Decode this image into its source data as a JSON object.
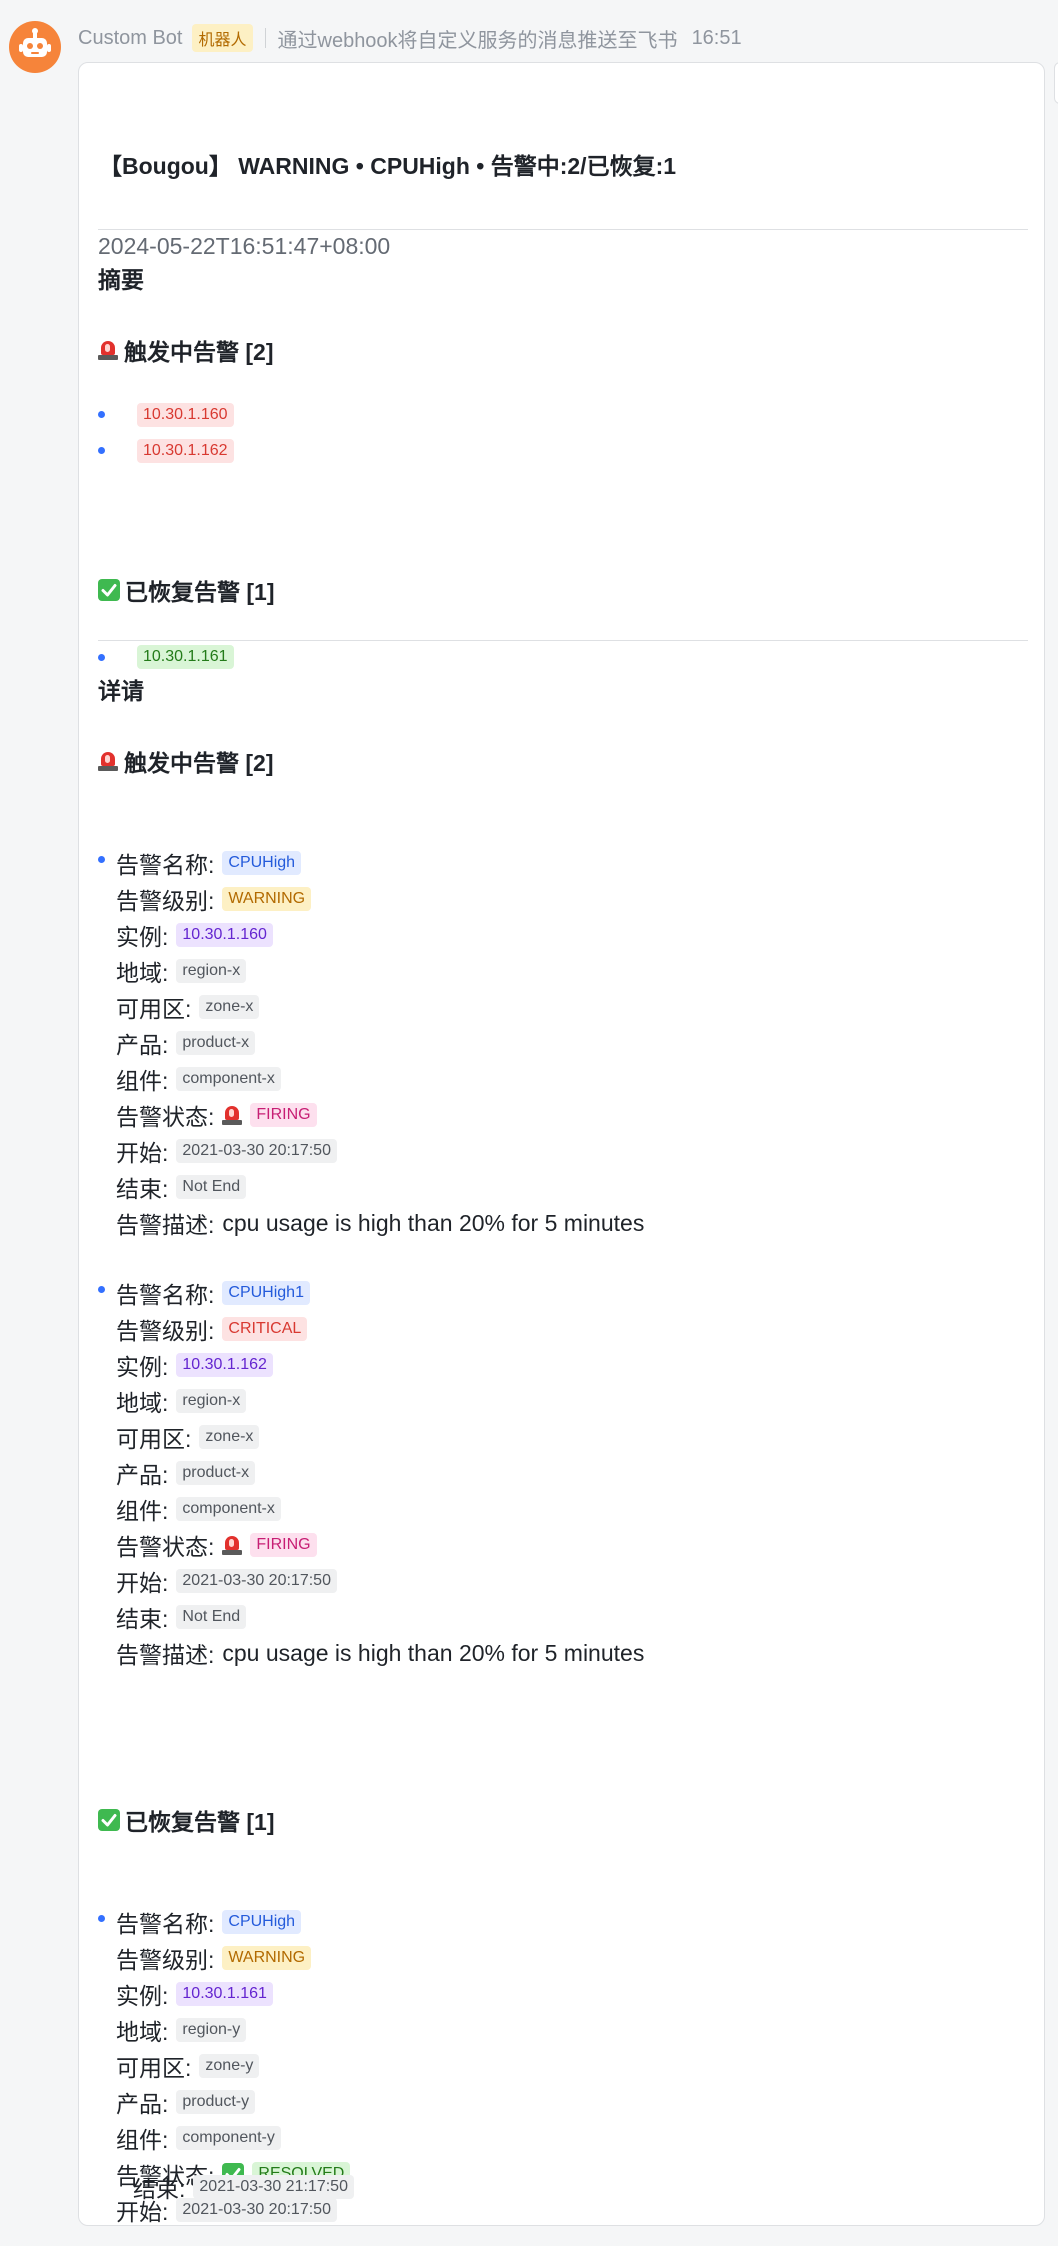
{
  "header": {
    "bot_name": "Custom Bot",
    "bot_tag": "机器人",
    "description": "通过webhook将自定义服务的消息推送至飞书",
    "time": "16:51"
  },
  "card": {
    "title": "【Bougou】 WARNING • CPUHigh • 告警中:2/已恢复:1",
    "timestamp": "2024-05-22T16:51:47+08:00",
    "summary": {
      "heading": "摘要",
      "firing_heading": "触发中告警 [2]",
      "firing_items": [
        "10.30.1.160",
        "10.30.1.162"
      ],
      "resolved_heading": "已恢复告警 [1]",
      "resolved_items": [
        "10.30.1.161"
      ]
    },
    "details": {
      "heading": "详请",
      "firing_heading": "触发中告警 [2]",
      "resolved_heading": "已恢复告警 [1]"
    },
    "labels": {
      "name": "告警名称:",
      "level": "告警级别:",
      "instance": "实例:",
      "region": "地域:",
      "zone": "可用区:",
      "product": "产品:",
      "component": "组件:",
      "status": "告警状态:",
      "start": "开始:",
      "end": "结束:",
      "desc": "告警描述:"
    },
    "alerts": [
      {
        "name": "CPUHigh",
        "level": "WARNING",
        "instance": "10.30.1.160",
        "region": "region-x",
        "zone": "zone-x",
        "product": "product-x",
        "component": "component-x",
        "status": "FIRING",
        "start": "2021-03-30 20:17:50",
        "end": "Not End",
        "desc": "cpu usage is high than 20% for 5 minutes"
      },
      {
        "name": "CPUHigh1",
        "level": "CRITICAL",
        "instance": "10.30.1.162",
        "region": "region-x",
        "zone": "zone-x",
        "product": "product-x",
        "component": "component-x",
        "status": "FIRING",
        "start": "2021-03-30 20:17:50",
        "end": "Not End",
        "desc": "cpu usage is high than 20% for 5 minutes"
      },
      {
        "name": "CPUHigh",
        "level": "WARNING",
        "instance": "10.30.1.161",
        "region": "region-y",
        "zone": "zone-y",
        "product": "product-y",
        "component": "component-y",
        "status": "RESOLVED",
        "start": "2021-03-30 20:17:50",
        "end": "2021-03-30 21:17:50"
      }
    ]
  },
  "icons": {
    "avatar": "robot-icon",
    "firing": "rotating-light-icon",
    "resolved": "check-mark-button-icon"
  },
  "colors": {
    "avatar": "#f6843a",
    "bullet": "#3370ff",
    "firing_tag": "#d83931",
    "resolved_tag": "#237b19"
  }
}
